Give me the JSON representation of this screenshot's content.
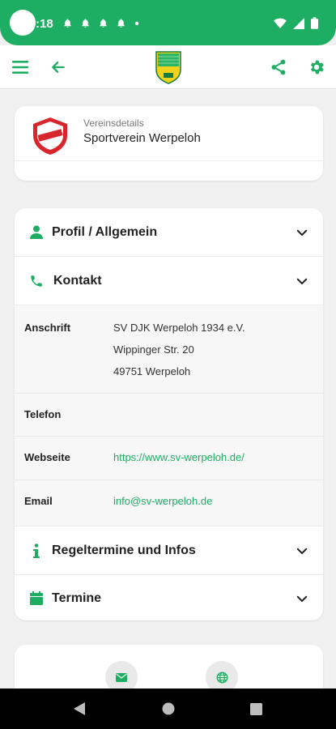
{
  "status_bar": {
    "time": "18",
    "colon_prefix": ":"
  },
  "club": {
    "subtitle": "Vereinsdetails",
    "name": "Sportverein Werpeloh"
  },
  "sections": {
    "profil": "Profil / Allgemein",
    "kontakt": "Kontakt",
    "regeltermine": "Regeltermine und Infos",
    "termine": "Termine"
  },
  "contact": {
    "anschrift_label": "Anschrift",
    "address_line1": "SV DJK Werpeloh 1934 e.V.",
    "address_line2": "Wippinger Str. 20",
    "address_line3": "49751 Werpeloh",
    "telefon_label": "Telefon",
    "webseite_label": "Webseite",
    "webseite_value": "https://www.sv-werpeloh.de/",
    "email_label": "Email",
    "email_value": "info@sv-werpeloh.de"
  },
  "colors": {
    "accent": "#1dae63",
    "background": "#f0f0f0"
  },
  "icons": [
    "menu-icon",
    "back-arrow-icon",
    "share-icon",
    "gear-icon",
    "person-icon",
    "phone-icon",
    "info-icon",
    "calendar-icon",
    "chevron-down-icon",
    "mail-icon",
    "globe-icon"
  ]
}
